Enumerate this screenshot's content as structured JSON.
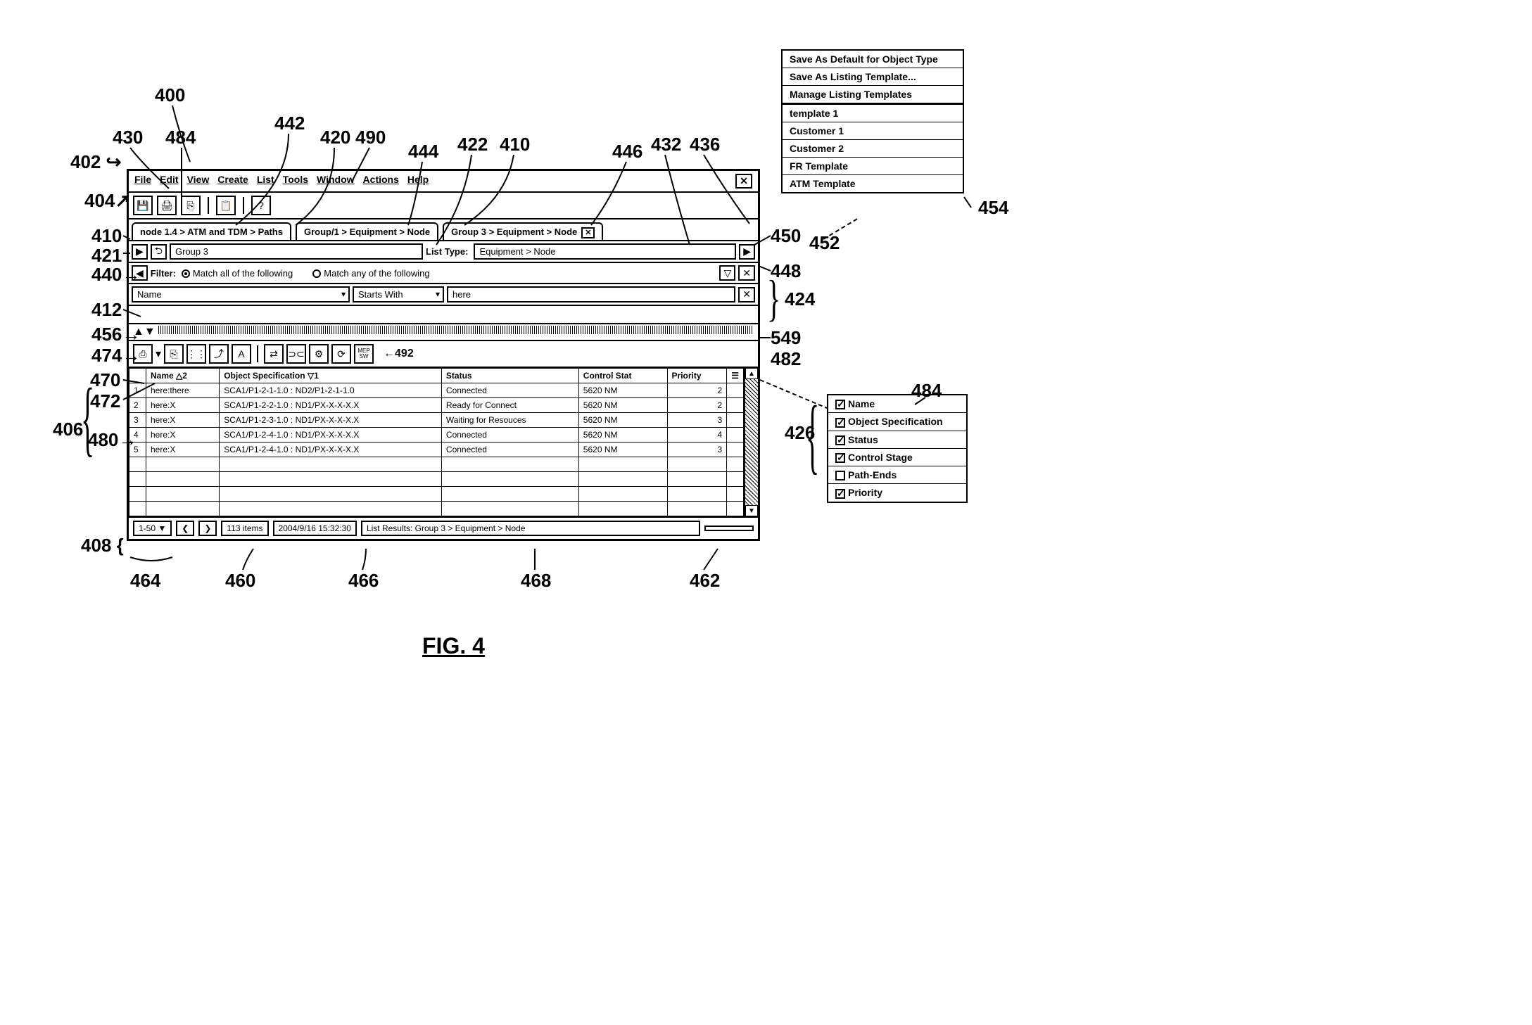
{
  "figure_label": "FIG. 4",
  "callouts": {
    "c400": "400",
    "c402": "402",
    "c404": "404",
    "c406": "406",
    "c408": "408",
    "c410a": "410",
    "c410b": "410",
    "c412": "412",
    "c420": "420",
    "c421": "421",
    "c422": "422",
    "c424": "424",
    "c426": "426",
    "c430": "430",
    "c432": "432",
    "c436": "436",
    "c440": "440",
    "c442": "442",
    "c444": "444",
    "c446": "446",
    "c448": "448",
    "c450": "450",
    "c452": "452",
    "c454": "454",
    "c456": "456",
    "c460": "460",
    "c462": "462",
    "c464": "464",
    "c466": "466",
    "c468": "468",
    "c470": "470",
    "c472": "472",
    "c474": "474",
    "c480": "480",
    "c482": "482",
    "c484a": "484",
    "c484b": "484",
    "c490": "490",
    "c492": "492",
    "c549": "549"
  },
  "menubar": {
    "file": "File",
    "edit": "Edit",
    "view": "View",
    "create": "Create",
    "list": "List",
    "tools": "Tools",
    "window": "Window",
    "actions": "Actions",
    "help": "Help",
    "close_glyph": "✕"
  },
  "toolbar": {
    "btn1": "💾",
    "btn2": "🖨",
    "btn3": "⎘",
    "btn4": "📋",
    "btn5": "?"
  },
  "tabs": {
    "t1": "node 1.4 > ATM and TDM > Paths",
    "t2": "Group/1 > Equipment > Node",
    "t3": "Group 3 > Equipment > Node",
    "close_glyph": "✕"
  },
  "navrow": {
    "arrow_glyph": "▶",
    "back_glyph": "⮌",
    "group_value": "Group 3",
    "list_type_label": "List Type:",
    "list_type_value": "Equipment > Node",
    "fwd_glyph": "▶"
  },
  "filter": {
    "label": "Filter:",
    "radio1": "Match all of the following",
    "radio2": "Match any of the following",
    "filter_icon": "▽",
    "clear_icon": "✕"
  },
  "filter_criteria": {
    "attr": "Name",
    "operator": "Starts With",
    "value": "here",
    "remove_glyph": "✕"
  },
  "toolbar2": {
    "b1": "⎙",
    "b2": "⎘",
    "b3": "⋮⋮",
    "b4": "⤴",
    "b5": "A",
    "b6": "⇄",
    "b7": "⊃⊂",
    "b8": "⚙",
    "b9": "⟳",
    "b10": "MEP\nSW",
    "callout_arrow": "←492"
  },
  "table": {
    "headers": {
      "num": "",
      "name": "Name △2",
      "objspec": "Object Specification ▽1",
      "status": "Status",
      "ctrl": "Control Stat",
      "priority": "Priority",
      "menu": "☰"
    },
    "rows": [
      {
        "n": "1",
        "name": "here:there",
        "objspec": "SCA1/P1-2-1-1.0 : ND2/P1-2-1-1.0",
        "status": "Connected",
        "ctrl": "5620 NM",
        "priority": "2"
      },
      {
        "n": "2",
        "name": "here:X",
        "objspec": "SCA1/P1-2-2-1.0 : ND1/PX-X-X-X.X",
        "status": "Ready for Connect",
        "ctrl": "5620 NM",
        "priority": "2"
      },
      {
        "n": "3",
        "name": "here:X",
        "objspec": "SCA1/P1-2-3-1.0 : ND1/PX-X-X-X.X",
        "status": "Waiting for Resouces",
        "ctrl": "5620 NM",
        "priority": "3"
      },
      {
        "n": "4",
        "name": "here:X",
        "objspec": "SCA1/P1-2-4-1.0 : ND1/PX-X-X-X.X",
        "status": "Connected",
        "ctrl": "5620 NM",
        "priority": "4"
      },
      {
        "n": "5",
        "name": "here:X",
        "objspec": "SCA1/P1-2-4-1.0 : ND1/PX-X-X-X.X",
        "status": "Connected",
        "ctrl": "5620 NM",
        "priority": "3"
      }
    ]
  },
  "statusbar": {
    "range": "1-50",
    "prev": "❮",
    "next": "❯",
    "count": "113 items",
    "timestamp": "2004/9/16  15:32:30",
    "results": "List Results: Group 3 > Equipment > Node"
  },
  "template_menu": {
    "m1": "Save As Default for Object Type",
    "m2": "Save As Listing Template...",
    "m3": "Manage Listing Templates",
    "t1": "template 1",
    "t2": "Customer 1",
    "t3": "Customer 2",
    "t4": "FR Template",
    "t5": "ATM Template"
  },
  "column_picker": {
    "c1": "Name",
    "c2": "Object Specification",
    "c3": "Status",
    "c4": "Control Stage",
    "c5": "Path-Ends",
    "c6": "Priority"
  }
}
